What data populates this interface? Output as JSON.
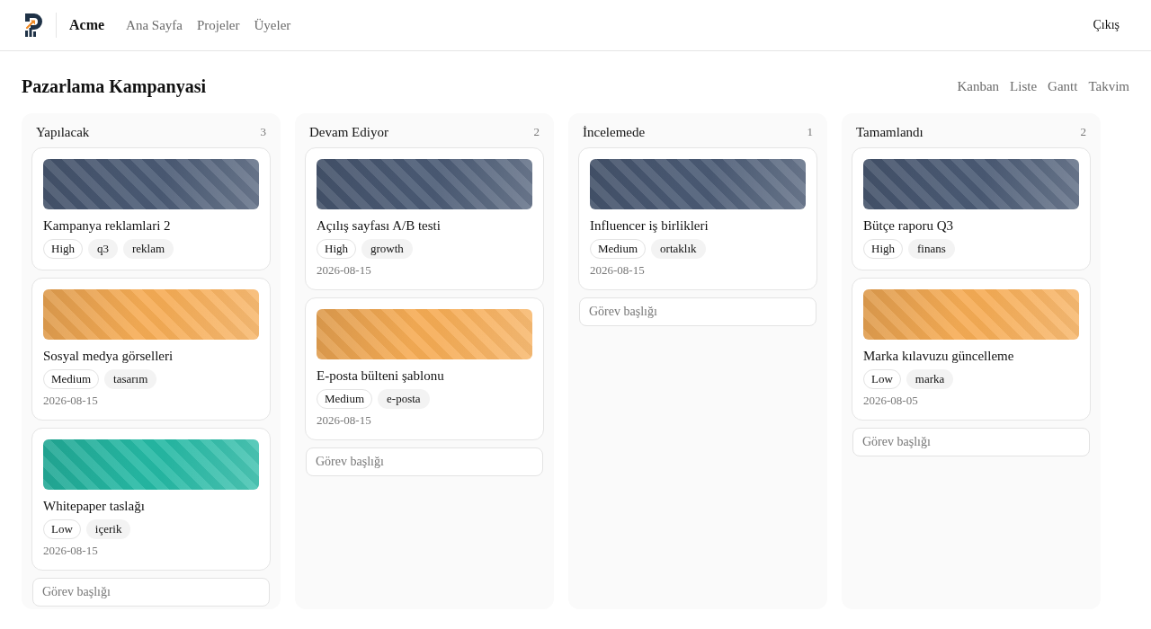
{
  "header": {
    "brand": "Acme",
    "nav": [
      "Ana Sayfa",
      "Projeler",
      "Üyeler"
    ],
    "logout": "Çıkış"
  },
  "page": {
    "title": "Pazarlama Kampanyasi",
    "views": [
      "Kanban",
      "Liste",
      "Gantt",
      "Takvim"
    ]
  },
  "columns": [
    {
      "title": "Yapılacak",
      "count": "3",
      "cards": [
        {
          "color": "#4a5a74",
          "title": "Kampanya reklamlari 2",
          "priority": "High",
          "tags": [
            "q3",
            "reklam"
          ]
        },
        {
          "color": "#f6ac55",
          "title": "Sosyal medya görselleri",
          "priority": "Medium",
          "tags": [
            "tasarım"
          ],
          "due": "2026-08-15"
        },
        {
          "color": "#25b9a4",
          "title": "Whitepaper taslağı",
          "priority": "Low",
          "tags": [
            "içerik"
          ],
          "due": "2026-08-15"
        }
      ],
      "new_task": {
        "placeholder": "Görev başlığı"
      }
    },
    {
      "title": "Devam Ediyor",
      "count": "2",
      "cards": [
        {
          "color": "#4a5a74",
          "title": "Açılış sayfası A/B testi",
          "priority": "High",
          "tags": [
            "growth"
          ],
          "due": "2026-08-15"
        },
        {
          "color": "#f6ac55",
          "title": "E-posta bülteni şablonu",
          "priority": "Medium",
          "tags": [
            "e-posta"
          ],
          "due": "2026-08-15"
        }
      ],
      "new_task": {
        "placeholder": "Görev başlığı"
      }
    },
    {
      "title": "İncelemede",
      "count": "1",
      "cards": [
        {
          "color": "#4a5a74",
          "title": "Influencer iş birlikleri",
          "priority": "Medium",
          "tags": [
            "ortaklık"
          ],
          "due": "2026-08-15"
        }
      ],
      "new_task": {
        "placeholder": "Görev başlığı"
      }
    },
    {
      "title": "Tamamlandı",
      "count": "2",
      "cards": [
        {
          "color": "#4a5a74",
          "title": "Bütçe raporu Q3",
          "priority": "High",
          "tags": [
            "finans"
          ]
        },
        {
          "color": "#f6ac55",
          "title": "Marka kılavuzu güncelleme",
          "priority": "Low",
          "tags": [
            "marka"
          ],
          "due": "2026-08-05"
        }
      ],
      "new_task": {
        "placeholder": "Görev başlığı"
      }
    }
  ]
}
